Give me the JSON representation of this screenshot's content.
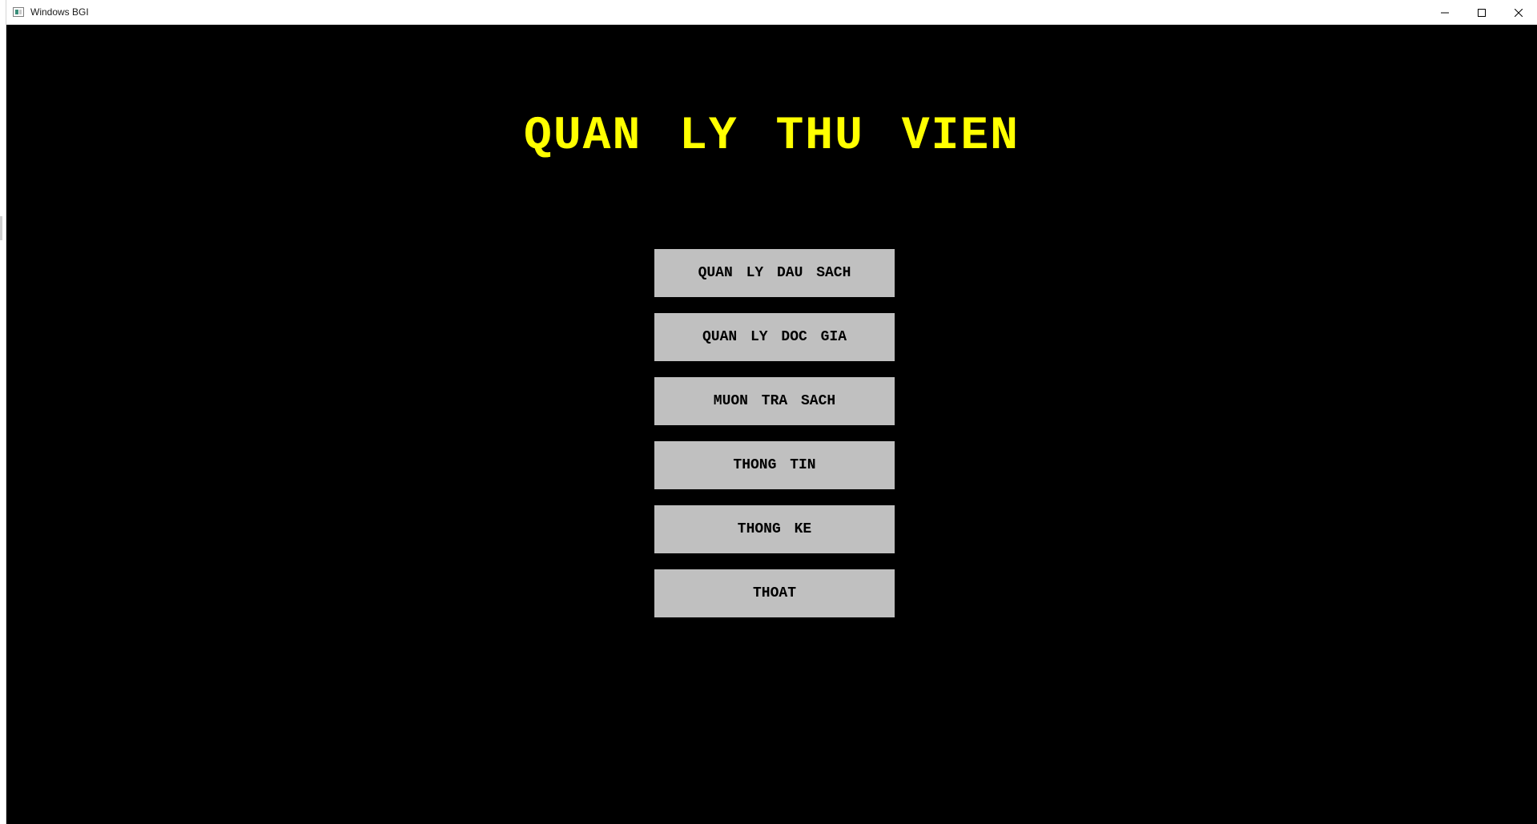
{
  "window": {
    "title": "Windows BGI",
    "controls": [
      "minimize-icon",
      "maximize-icon",
      "close-icon"
    ]
  },
  "app": {
    "title": "QUAN LY THU VIEN",
    "title_color": "#ffff00",
    "background": "#000000"
  },
  "menu": {
    "button_color": "#c0c0c0",
    "items": [
      {
        "label": "QUAN LY DAU SACH"
      },
      {
        "label": "QUAN LY DOC GIA"
      },
      {
        "label": "MUON TRA SACH"
      },
      {
        "label": "THONG TIN"
      },
      {
        "label": "THONG KE"
      },
      {
        "label": "THOAT"
      }
    ]
  }
}
